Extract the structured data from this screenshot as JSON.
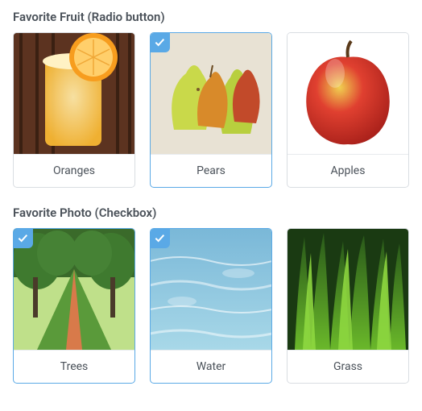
{
  "sections": [
    {
      "title": "Favorite Fruit (Radio button)",
      "type": "radio",
      "items": [
        {
          "label": "Oranges",
          "selected": false,
          "image": "oranges"
        },
        {
          "label": "Pears",
          "selected": true,
          "image": "pears"
        },
        {
          "label": "Apples",
          "selected": false,
          "image": "apples"
        }
      ]
    },
    {
      "title": "Favorite Photo (Checkbox)",
      "type": "checkbox",
      "items": [
        {
          "label": "Trees",
          "selected": true,
          "image": "trees"
        },
        {
          "label": "Water",
          "selected": true,
          "image": "water"
        },
        {
          "label": "Grass",
          "selected": false,
          "image": "grass"
        }
      ]
    }
  ]
}
